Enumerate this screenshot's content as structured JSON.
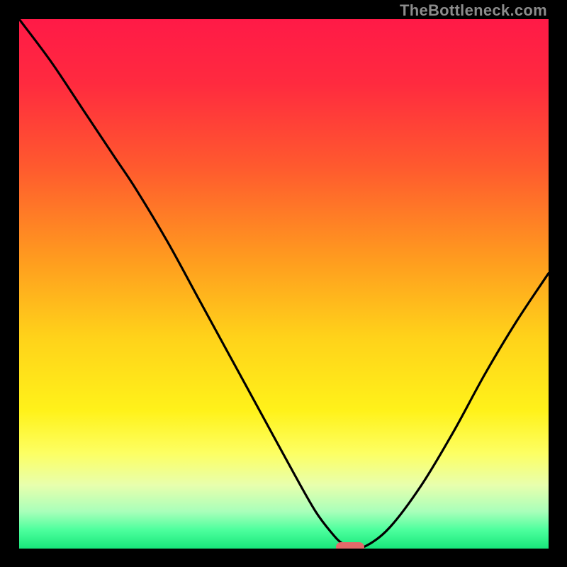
{
  "watermark": "TheBottleneck.com",
  "colors": {
    "gradient_stops": [
      {
        "offset": 0.0,
        "color": "#ff1a47"
      },
      {
        "offset": 0.12,
        "color": "#ff2a3f"
      },
      {
        "offset": 0.28,
        "color": "#ff5a2e"
      },
      {
        "offset": 0.45,
        "color": "#ff9a1f"
      },
      {
        "offset": 0.6,
        "color": "#ffd21a"
      },
      {
        "offset": 0.74,
        "color": "#fff21a"
      },
      {
        "offset": 0.82,
        "color": "#fdff63"
      },
      {
        "offset": 0.88,
        "color": "#e8ffad"
      },
      {
        "offset": 0.93,
        "color": "#a9ffba"
      },
      {
        "offset": 0.965,
        "color": "#4cff9d"
      },
      {
        "offset": 1.0,
        "color": "#18e67b"
      }
    ],
    "marker": "#e46a6a",
    "curve": "#000000"
  },
  "chart_data": {
    "type": "line",
    "title": "",
    "xlabel": "",
    "ylabel": "",
    "xlim": [
      0,
      100
    ],
    "ylim": [
      0,
      100
    ],
    "grid": false,
    "series": [
      {
        "name": "bottleneck-curve",
        "x": [
          0,
          6,
          12,
          18,
          22,
          28,
          34,
          40,
          46,
          52,
          56,
          59,
          61,
          63,
          65.5,
          70,
          76,
          82,
          88,
          94,
          100
        ],
        "values": [
          100,
          92,
          83,
          74,
          68,
          58,
          47,
          36,
          25,
          14,
          7,
          3,
          1,
          0.5,
          0.5,
          4,
          12,
          22,
          33,
          43,
          52
        ]
      }
    ],
    "annotations": [
      {
        "type": "marker",
        "x": 62.5,
        "y": 0.3,
        "label": "optimal-point"
      }
    ]
  }
}
